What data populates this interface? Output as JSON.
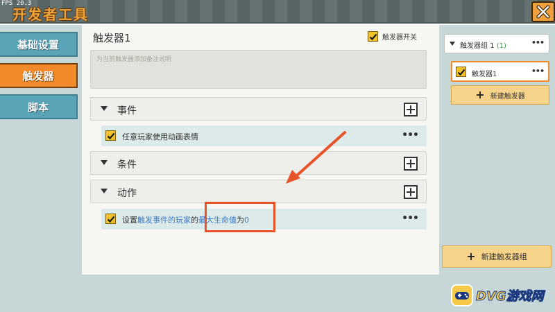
{
  "window": {
    "fps": "FPS 20.3",
    "title": "开发者工具"
  },
  "sidebar": {
    "tabs": [
      {
        "label": "基础设置",
        "active": false
      },
      {
        "label": "触发器",
        "active": true
      },
      {
        "label": "脚本",
        "active": false
      }
    ]
  },
  "main": {
    "trigger_name": "触发器1",
    "toggle_label": "触发器开关",
    "toggle_checked": true,
    "note_placeholder": "为当前触发器添加备注说明",
    "sections": {
      "event": {
        "label": "事件",
        "items": [
          {
            "text": "任意玩家使用动画表情",
            "checked": true
          }
        ]
      },
      "condition": {
        "label": "条件"
      },
      "action": {
        "label": "动作",
        "items": [
          {
            "text_prefix": "设置",
            "text_highlight_1": "触发事件的玩家",
            "text_middle": "的",
            "text_highlight_2": "最大生命值",
            "text_middle_2": "为",
            "text_highlight_3": "0",
            "checked": true
          }
        ]
      }
    }
  },
  "right_panel": {
    "group_title": "触发器组 1",
    "group_count": "(1)",
    "trigger_item": "触发器1",
    "new_trigger_label": "新建触发器",
    "new_group_label": "新建触发器组"
  },
  "watermark": {
    "text": "DVG游戏网"
  },
  "colors": {
    "accent_orange": "#f08a2a",
    "tab_blue": "#5aa4b8",
    "highlight_red": "#e8532a",
    "link_blue": "#3a78c8",
    "checkbox_yellow": "#f2c22a"
  }
}
